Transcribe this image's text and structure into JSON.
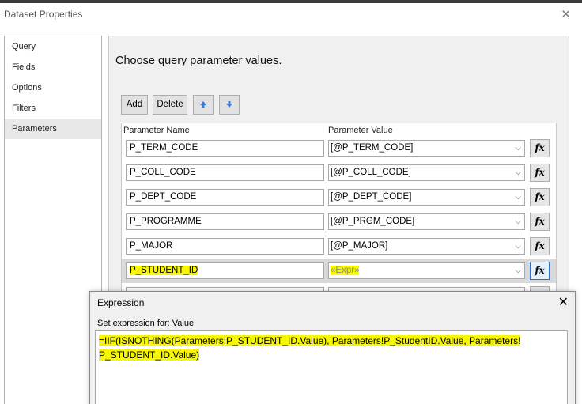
{
  "window": {
    "title": "Dataset Properties",
    "close_icon": "close-icon"
  },
  "nav": {
    "items": [
      {
        "label": "Query",
        "selected": false
      },
      {
        "label": "Fields",
        "selected": false
      },
      {
        "label": "Options",
        "selected": false
      },
      {
        "label": "Filters",
        "selected": false
      },
      {
        "label": "Parameters",
        "selected": true
      }
    ]
  },
  "main": {
    "heading": "Choose query parameter values.",
    "toolbar": {
      "add_label": "Add",
      "delete_label": "Delete",
      "move_up_icon": "arrow-up-icon",
      "move_down_icon": "arrow-down-icon",
      "arrow_color": "#3a7bd5"
    },
    "grid": {
      "col_name": "Parameter Name",
      "col_value": "Parameter Value",
      "fx_label": "fx",
      "rows": [
        {
          "name": "P_TERM_CODE",
          "value": "[@P_TERM_CODE]"
        },
        {
          "name": "P_COLL_CODE",
          "value": "[@P_COLL_CODE]"
        },
        {
          "name": "P_DEPT_CODE",
          "value": "[@P_DEPT_CODE]"
        },
        {
          "name": "P_PROGRAMME",
          "value": "[@P_PRGM_CODE]"
        },
        {
          "name": "P_MAJOR",
          "value": "[@P_MAJOR]"
        },
        {
          "name": "P_STUDENT_ID",
          "value": "«Expr»",
          "selected": true
        }
      ]
    }
  },
  "expression_dialog": {
    "title": "Expression",
    "label": "Set expression for: Value",
    "line1": "=IIF(ISNOTHING(Parameters!P_STUDENT_ID.Value), Parameters!P_StudentID.Value, Parameters!",
    "line2": "P_STUDENT_ID.Value)",
    "highlight_color": "#f7f700"
  }
}
